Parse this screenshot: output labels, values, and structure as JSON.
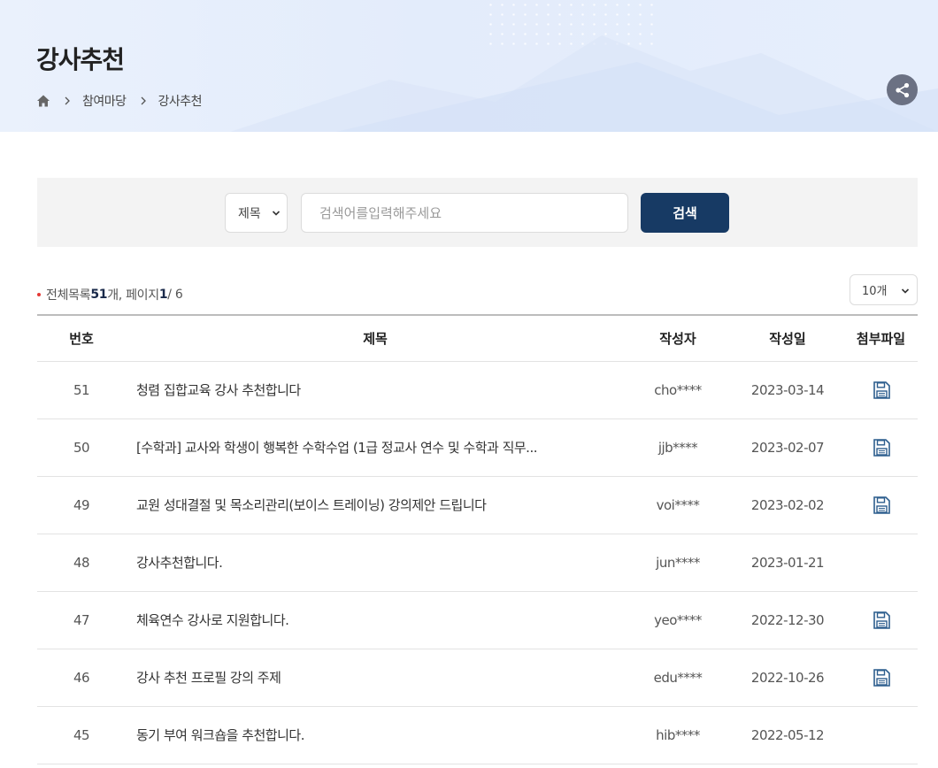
{
  "header": {
    "title": "강사추천",
    "breadcrumb": [
      {
        "label": "참여마당"
      },
      {
        "label": "강사추천"
      }
    ]
  },
  "search": {
    "field_select": "제목",
    "placeholder": "검색어를입력해주세요",
    "button_label": "검색"
  },
  "list_info": {
    "prefix": "전체목록 ",
    "total": "51",
    "unit": "개, 페이지",
    "current_page": "1",
    "total_pages": " / 6"
  },
  "per_page": "10개",
  "table": {
    "headers": {
      "no": "번호",
      "title": "제목",
      "author": "작성자",
      "date": "작성일",
      "attachment": "첨부파일"
    },
    "rows": [
      {
        "no": "51",
        "title": "청렴 집합교육 강사 추천합니다",
        "author": "cho****",
        "date": "2023-03-14",
        "has_file": true
      },
      {
        "no": "50",
        "title": "[수학과] 교사와 학생이 행복한 수학수업 (1급 정교사 연수 및 수학과 직무...",
        "author": "jjb****",
        "date": "2023-02-07",
        "has_file": true
      },
      {
        "no": "49",
        "title": "교원 성대결절 및 목소리관리(보이스 트레이닝) 강의제안 드립니다",
        "author": "voi****",
        "date": "2023-02-02",
        "has_file": true
      },
      {
        "no": "48",
        "title": "강사추천합니다.",
        "author": "jun****",
        "date": "2023-01-21",
        "has_file": false
      },
      {
        "no": "47",
        "title": "체육연수 강사로 지원합니다.",
        "author": "yeo****",
        "date": "2022-12-30",
        "has_file": true
      },
      {
        "no": "46",
        "title": "강사 추천 프로필 강의 주제",
        "author": "edu****",
        "date": "2022-10-26",
        "has_file": true
      },
      {
        "no": "45",
        "title": "동기 부여 워크숍을 추천합니다.",
        "author": "hib****",
        "date": "2022-05-12",
        "has_file": false
      }
    ]
  },
  "colors": {
    "primary_button": "#173a64",
    "file_icon": "#2d5e8e",
    "share_button": "#6b7183",
    "bullet": "#e53935"
  },
  "icons": {
    "home": "home-icon",
    "separator": "chevron-right-icon",
    "share": "share-icon",
    "attachment": "save-file-icon"
  }
}
